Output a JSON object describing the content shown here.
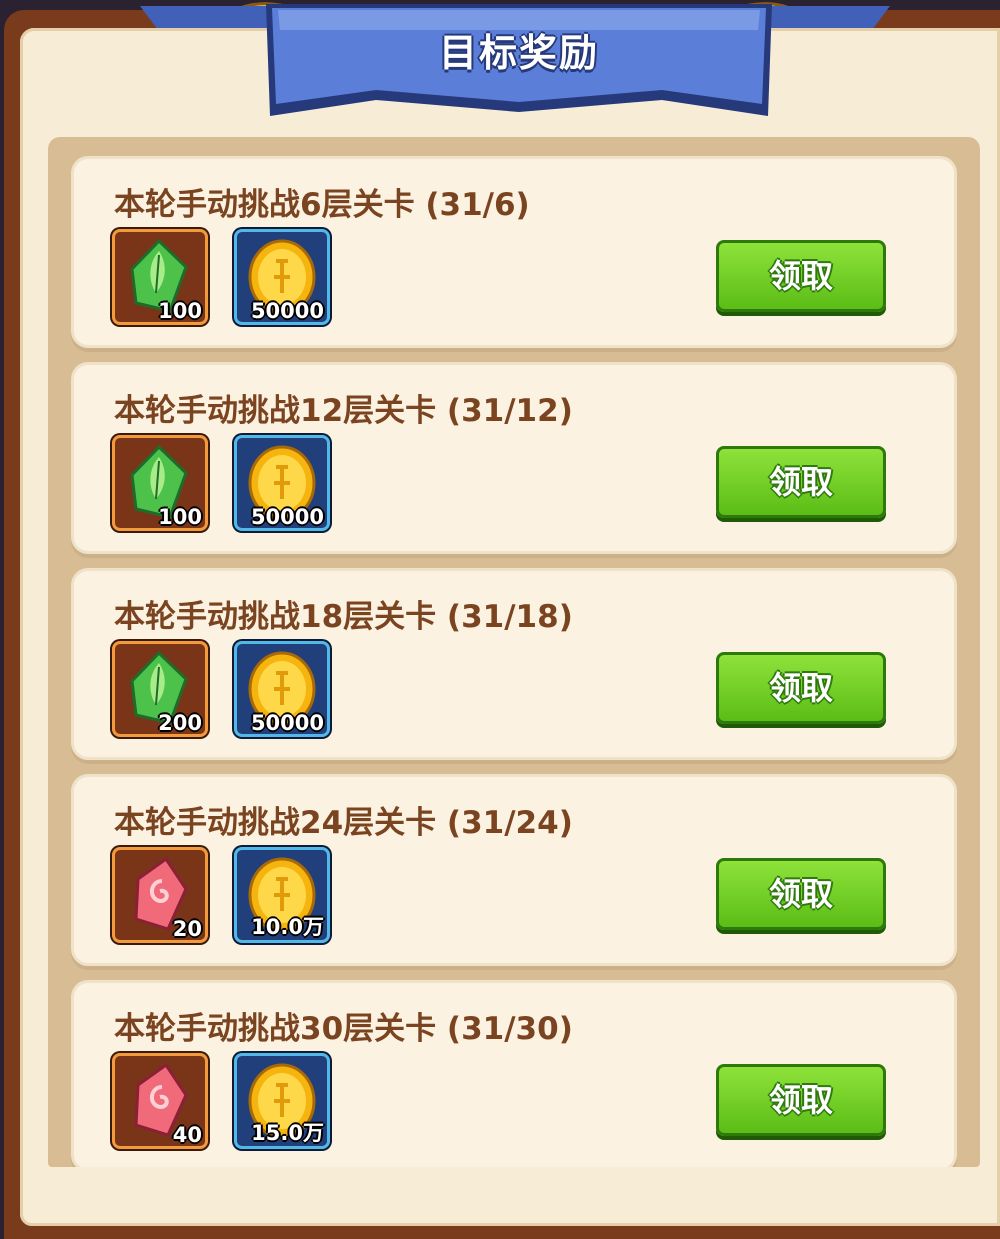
{
  "header": {
    "title": "目标奖励"
  },
  "colors": {
    "claim": "#6bcc20",
    "panel": "#f7ecd6",
    "title_text": "#7b4421"
  },
  "tasks": [
    {
      "title": "本轮手动挑战6层关卡 (31/6)",
      "rewards": [
        {
          "icon": "green-leaf-gem-icon",
          "amount": "100"
        },
        {
          "icon": "gold-coin-icon",
          "amount": "50000"
        }
      ],
      "button": "领取"
    },
    {
      "title": "本轮手动挑战12层关卡 (31/12)",
      "rewards": [
        {
          "icon": "green-leaf-gem-icon",
          "amount": "100"
        },
        {
          "icon": "gold-coin-icon",
          "amount": "50000"
        }
      ],
      "button": "领取"
    },
    {
      "title": "本轮手动挑战18层关卡 (31/18)",
      "rewards": [
        {
          "icon": "green-leaf-gem-icon",
          "amount": "200"
        },
        {
          "icon": "gold-coin-icon",
          "amount": "50000"
        }
      ],
      "button": "领取"
    },
    {
      "title": "本轮手动挑战24层关卡 (31/24)",
      "rewards": [
        {
          "icon": "pink-spiral-gem-icon",
          "amount": "20"
        },
        {
          "icon": "gold-coin-icon",
          "amount": "10.0万"
        }
      ],
      "button": "领取"
    },
    {
      "title": "本轮手动挑战30层关卡 (31/30)",
      "rewards": [
        {
          "icon": "pink-spiral-gem-icon",
          "amount": "40"
        },
        {
          "icon": "gold-coin-icon",
          "amount": "15.0万"
        }
      ],
      "button": "领取"
    }
  ]
}
